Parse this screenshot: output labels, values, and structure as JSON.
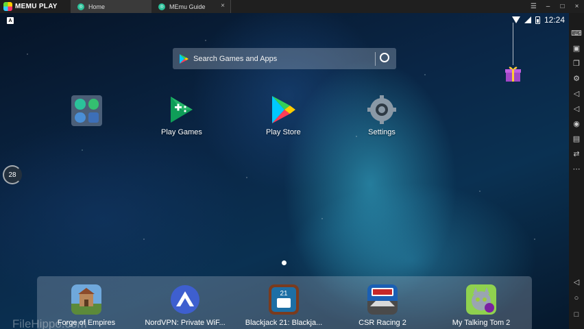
{
  "titlebar": {
    "brand": "MEMU PLAY",
    "tabs": [
      {
        "label": "Home"
      },
      {
        "label": "MEmu Guide",
        "close": "×"
      }
    ],
    "controls": {
      "menu": "☰",
      "minimize": "–",
      "maximize": "□",
      "close": "×"
    }
  },
  "status": {
    "a_badge": "A",
    "time": "12:24"
  },
  "search": {
    "placeholder": "Search Games and Apps"
  },
  "desktop": {
    "apps": [
      {
        "label": "Play Games"
      },
      {
        "label": "Play Store"
      },
      {
        "label": "Settings"
      }
    ],
    "gauge": "28"
  },
  "dock": {
    "apps": [
      {
        "label": "Forge of Empires"
      },
      {
        "label": "NordVPN: Private WiF..."
      },
      {
        "label": "Blackjack 21: Blackja..."
      },
      {
        "label": "CSR Racing 2"
      },
      {
        "label": "My Talking Tom 2"
      }
    ]
  },
  "watermark": "FileHippo.com",
  "colors": {
    "accent": "#2bc29a",
    "titlebar": "#1f1f1f",
    "toolbar": "#1b1b1b"
  }
}
